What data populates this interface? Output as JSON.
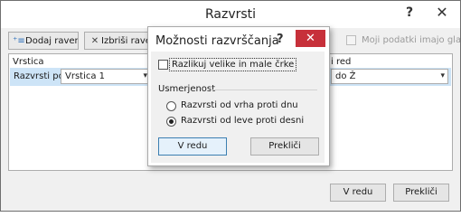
{
  "window": {
    "title": "Razvrsti",
    "help": "?",
    "close": "✕"
  },
  "toolbar": {
    "add_level_label": "Dodaj raven",
    "delete_level_label": "Izbriši raven",
    "header_checkbox_label": "Moji podatki imajo glave"
  },
  "grid": {
    "headers": {
      "column": "Vrstica",
      "order": "i red"
    },
    "row": {
      "label": "Razvrsti po",
      "sort_by_value": "Vrstica 1",
      "order_value": "do Ž"
    }
  },
  "footer": {
    "ok_label": "V redu",
    "cancel_label": "Prekliči"
  },
  "options_dialog": {
    "title": "Možnosti razvrščanja",
    "help": "?",
    "close": "✕",
    "case_sensitive_label": "Razlikuj velike in male črke",
    "case_sensitive_checked": false,
    "orientation_label": "Usmerjenost",
    "orientation_options": [
      {
        "label": "Razvrsti od vrha proti dnu",
        "selected": false
      },
      {
        "label": "Razvrsti od leve proti desni",
        "selected": true
      }
    ],
    "ok_label": "V redu",
    "cancel_label": "Prekliči"
  }
}
